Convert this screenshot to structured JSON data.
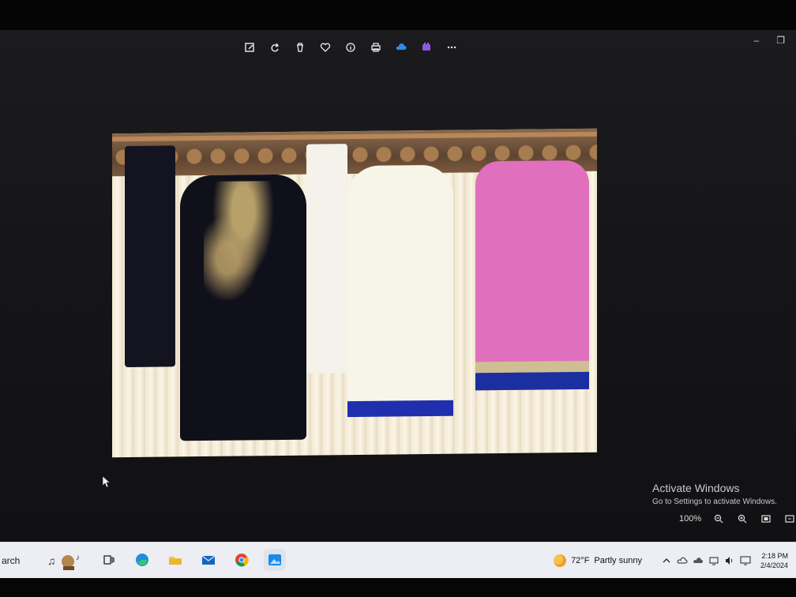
{
  "toolbar": {
    "buttons": [
      {
        "icon": "edit-icon"
      },
      {
        "icon": "rotate-icon"
      },
      {
        "icon": "delete-icon"
      },
      {
        "icon": "favorite-icon"
      },
      {
        "icon": "info-icon"
      },
      {
        "icon": "print-icon"
      },
      {
        "icon": "onedrive-icon"
      },
      {
        "icon": "clipchamp-icon"
      },
      {
        "icon": "more-icon"
      }
    ]
  },
  "window_controls": {
    "minimize": "–",
    "restore": "❐"
  },
  "activation": {
    "title": "Activate Windows",
    "subtitle": "Go to Settings to activate Windows."
  },
  "zoom": {
    "level": "100%"
  },
  "taskbar": {
    "search_fragment": "arch",
    "weather_temp": "72°F",
    "weather_text": "Partly sunny",
    "time": "2:18 PM",
    "date": "2/4/2024",
    "apps": [
      "task-view-icon",
      "edge-icon",
      "file-explorer-icon",
      "mail-icon",
      "chrome-icon",
      "photos-icon"
    ]
  }
}
